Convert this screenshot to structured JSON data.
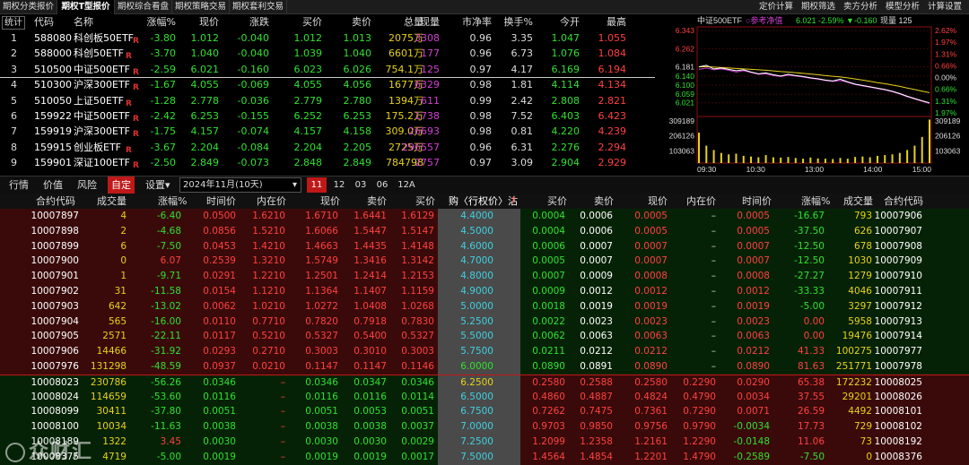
{
  "top_nav": {
    "tabs": [
      "期权分类报价",
      "期权T型报价",
      "期权综合看盘",
      "期权策略交易",
      "期权套利交易"
    ],
    "active": 1,
    "right_tools": [
      "定价计算",
      "期权筛选",
      "卖方分析",
      "模型分析",
      "计算设置"
    ]
  },
  "quote_table": {
    "corner_label": "统计",
    "headers": {
      "code": "代码",
      "name": "名称",
      "chg_pct": "涨幅%",
      "price": "现价",
      "diff": "涨跌",
      "bid": "买价",
      "ask": "卖价",
      "vol": "总量",
      "cur": "现量",
      "pb": "市净率",
      "turn": "换手%",
      "open": "今开",
      "high": "最高"
    },
    "rows": [
      {
        "idx": "1",
        "code": "588080",
        "name": "科创板50ETF",
        "r": "R",
        "chg": "-3.80",
        "price": "1.012",
        "diff": "-0.040",
        "bid": "1.012",
        "ask": "1.013",
        "vol": "2075万",
        "cur": "3308",
        "pb": "0.96",
        "turn": "3.35",
        "open": "1.047",
        "high": "1.055"
      },
      {
        "idx": "2",
        "code": "588000",
        "name": "科创50ETF",
        "r": "R",
        "chg": "-3.70",
        "price": "1.040",
        "diff": "-0.040",
        "bid": "1.039",
        "ask": "1.040",
        "vol": "6601万",
        "cur": "177",
        "pb": "0.96",
        "turn": "6.73",
        "open": "1.076",
        "high": "1.084"
      },
      {
        "idx": "3",
        "code": "510500",
        "name": "中证500ETF",
        "r": "R",
        "chg": "-2.59",
        "price": "6.021",
        "diff": "-0.160",
        "bid": "6.023",
        "ask": "6.026",
        "vol": "754.1万",
        "cur": "125",
        "pb": "0.97",
        "turn": "4.17",
        "open": "6.169",
        "high": "6.194"
      },
      {
        "idx": "4",
        "code": "510300",
        "name": "沪深300ETF",
        "r": "R",
        "chg": "-1.67",
        "price": "4.055",
        "diff": "-0.069",
        "bid": "4.055",
        "ask": "4.056",
        "vol": "1677万",
        "cur": "6329",
        "pb": "0.98",
        "turn": "1.81",
        "open": "4.114",
        "high": "4.134"
      },
      {
        "idx": "5",
        "code": "510050",
        "name": "上证50ETF",
        "r": "R",
        "chg": "-1.28",
        "price": "2.778",
        "diff": "-0.036",
        "bid": "2.779",
        "ask": "2.780",
        "vol": "1394万",
        "cur": "611",
        "pb": "0.99",
        "turn": "2.42",
        "open": "2.808",
        "high": "2.821"
      },
      {
        "idx": "6",
        "code": "159922",
        "name": "中证500ETF",
        "r": "R",
        "chg": "-2.42",
        "price": "6.253",
        "diff": "-0.155",
        "bid": "6.252",
        "ask": "6.253",
        "vol": "175.2万",
        "cur": "1738",
        "pb": "0.98",
        "turn": "7.52",
        "open": "6.403",
        "high": "6.423"
      },
      {
        "idx": "7",
        "code": "159919",
        "name": "沪深300ETF",
        "r": "R",
        "chg": "-1.75",
        "price": "4.157",
        "diff": "-0.074",
        "bid": "4.157",
        "ask": "4.158",
        "vol": "309.0万",
        "cur": "26693",
        "pb": "0.98",
        "turn": "0.81",
        "open": "4.220",
        "high": "4.239"
      },
      {
        "idx": "8",
        "code": "159915",
        "name": "创业板ETF",
        "r": "R",
        "chg": "-3.67",
        "price": "2.204",
        "diff": "-0.084",
        "bid": "2.204",
        "ask": "2.205",
        "vol": "2725万",
        "cur": "296557",
        "pb": "0.96",
        "turn": "6.31",
        "open": "2.276",
        "high": "2.294"
      },
      {
        "idx": "9",
        "code": "159901",
        "name": "深证100ETF",
        "r": "R",
        "chg": "-2.50",
        "price": "2.849",
        "diff": "-0.073",
        "bid": "2.848",
        "ask": "2.849",
        "vol": "784798",
        "cur": "2757",
        "pb": "0.97",
        "turn": "3.09",
        "open": "2.904",
        "high": "2.929"
      }
    ]
  },
  "mini_chart": {
    "title": "中证500ETF",
    "ref_label": "参考净值",
    "price": "6.021",
    "pct": "-2.59%",
    "diff": "▼-0.160",
    "cur_vol_label": "现量",
    "cur_vol": "125",
    "left_ticks": [
      "6.343",
      "6.262",
      "6.181",
      "6.140",
      "6.100",
      "6.059",
      "6.021"
    ],
    "right_ticks": [
      "2.62%",
      "1.97%",
      "1.31%",
      "0.66%",
      "0.00%",
      "0.66%",
      "1.31%",
      "1.97%"
    ],
    "vol_left": [
      "309189",
      "206126",
      "103063"
    ],
    "vol_right": [
      "309189",
      "206126",
      "103063"
    ],
    "time_ticks": [
      "09:30",
      "10:30",
      "13:00",
      "14:00",
      "15:00"
    ],
    "price_line": [
      6.181,
      6.188,
      6.172,
      6.176,
      6.17,
      6.164,
      6.168,
      6.158,
      6.15,
      6.154,
      6.146,
      6.14,
      6.148,
      6.142,
      6.138,
      6.132,
      6.128,
      6.122,
      6.118,
      6.126,
      6.114,
      6.104,
      6.098,
      6.092,
      6.086,
      6.08,
      6.072,
      6.062,
      6.05,
      6.04,
      6.03,
      6.021
    ],
    "avg_line": [
      6.181,
      6.182,
      6.18,
      6.178,
      6.176,
      6.174,
      6.172,
      6.17,
      6.168,
      6.166,
      6.163,
      6.16,
      6.158,
      6.155,
      6.152,
      6.149,
      6.146,
      6.142,
      6.139,
      6.136,
      6.132,
      6.127,
      6.122,
      6.117,
      6.111,
      6.106,
      6.1,
      6.094,
      6.087,
      6.08,
      6.073,
      6.066
    ],
    "ref_line": [
      6.17,
      6.176,
      6.168,
      6.172,
      6.166,
      6.158,
      6.164,
      6.156,
      6.148,
      6.15,
      6.142,
      6.138,
      6.144,
      6.14,
      6.136,
      6.13,
      6.126,
      6.12,
      6.116,
      6.12,
      6.112,
      6.102,
      6.096,
      6.09,
      6.084,
      6.078,
      6.07,
      6.06,
      6.048,
      6.038,
      6.028,
      6.018
    ],
    "volume": [
      210000,
      120000,
      90000,
      70000,
      60000,
      65000,
      50000,
      45000,
      40000,
      55000,
      40000,
      38000,
      42000,
      35000,
      30000,
      38000,
      32000,
      30000,
      28000,
      35000,
      30000,
      42000,
      45000,
      40000,
      50000,
      55000,
      60000,
      70000,
      90000,
      120000,
      180000,
      300000
    ]
  },
  "chain_tabs": {
    "tabs": [
      "行情",
      "价值",
      "风险",
      "自定",
      "设置▾"
    ],
    "active_tab": 3,
    "expiry": "2024年11月(10天)",
    "months": [
      "11",
      "12",
      "03",
      "06",
      "12A"
    ],
    "active_month": 0
  },
  "chain_headers": {
    "left": [
      "合约代码",
      "成交量",
      "涨幅%",
      "时间价",
      "内在价",
      "现价",
      "卖价",
      "买价"
    ],
    "strike": "购〈行权价〉沽",
    "right": [
      "买价",
      "卖价",
      "现价",
      "内在价",
      "时间价",
      "涨幅%",
      "成交量",
      "合约代码"
    ]
  },
  "chain_rows": [
    {
      "lc": "10007897",
      "lv": "4",
      "lchg": "-6.40",
      "lt": "0.0500",
      "li": "1.6210",
      "lp": "1.6710",
      "la": "1.6441",
      "lb": "1.6129",
      "k": "4.4000",
      "rb": "0.0004",
      "ra": "0.0006",
      "rp": "0.0005",
      "ri": "–",
      "rt": "0.0005",
      "rchg": "-16.67",
      "rv": "793",
      "rc": "10007906"
    },
    {
      "lc": "10007898",
      "lv": "2",
      "lchg": "-4.68",
      "lt": "0.0856",
      "li": "1.5210",
      "lp": "1.6066",
      "la": "1.5447",
      "lb": "1.5147",
      "k": "4.5000",
      "rb": "0.0004",
      "ra": "0.0006",
      "rp": "0.0005",
      "ri": "–",
      "rt": "0.0005",
      "rchg": "-37.50",
      "rv": "626",
      "rc": "10007907"
    },
    {
      "lc": "10007899",
      "lv": "6",
      "lchg": "-7.50",
      "lt": "0.0453",
      "li": "1.4210",
      "lp": "1.4663",
      "la": "1.4435",
      "lb": "1.4148",
      "k": "4.6000",
      "rb": "0.0006",
      "ra": "0.0007",
      "rp": "0.0007",
      "ri": "–",
      "rt": "0.0007",
      "rchg": "-12.50",
      "rv": "678",
      "rc": "10007908"
    },
    {
      "lc": "10007900",
      "lv": "0",
      "lchg": "6.07",
      "lt": "0.2539",
      "li": "1.3210",
      "lp": "1.5749",
      "la": "1.3416",
      "lb": "1.3142",
      "k": "4.7000",
      "rb": "0.0005",
      "ra": "0.0007",
      "rp": "0.0007",
      "ri": "–",
      "rt": "0.0007",
      "rchg": "-12.50",
      "rv": "1030",
      "rc": "10007909"
    },
    {
      "lc": "10007901",
      "lv": "1",
      "lchg": "-9.71",
      "lt": "0.0291",
      "li": "1.2210",
      "lp": "1.2501",
      "la": "1.2414",
      "lb": "1.2153",
      "k": "4.8000",
      "rb": "0.0007",
      "ra": "0.0009",
      "rp": "0.0008",
      "ri": "–",
      "rt": "0.0008",
      "rchg": "-27.27",
      "rv": "1279",
      "rc": "10007910"
    },
    {
      "lc": "10007902",
      "lv": "31",
      "lchg": "-11.58",
      "lt": "0.0154",
      "li": "1.1210",
      "lp": "1.1364",
      "la": "1.1407",
      "lb": "1.1159",
      "k": "4.9000",
      "rb": "0.0009",
      "ra": "0.0012",
      "rp": "0.0012",
      "ri": "–",
      "rt": "0.0012",
      "rchg": "-33.33",
      "rv": "4046",
      "rc": "10007911"
    },
    {
      "lc": "10007903",
      "lv": "642",
      "lchg": "-13.02",
      "lt": "0.0062",
      "li": "1.0210",
      "lp": "1.0272",
      "la": "1.0408",
      "lb": "1.0268",
      "k": "5.0000",
      "rb": "0.0018",
      "ra": "0.0019",
      "rp": "0.0019",
      "ri": "–",
      "rt": "0.0019",
      "rchg": "-5.00",
      "rv": "3297",
      "rc": "10007912"
    },
    {
      "lc": "10007904",
      "lv": "565",
      "lchg": "-16.00",
      "lt": "0.0110",
      "li": "0.7710",
      "lp": "0.7820",
      "la": "0.7918",
      "lb": "0.7830",
      "k": "5.2500",
      "rb": "0.0022",
      "ra": "0.0023",
      "rp": "0.0023",
      "ri": "–",
      "rt": "0.0023",
      "rchg": "0.00",
      "rv": "5958",
      "rc": "10007913"
    },
    {
      "lc": "10007905",
      "lv": "2571",
      "lchg": "-22.11",
      "lt": "0.0117",
      "li": "0.5210",
      "lp": "0.5327",
      "la": "0.5400",
      "lb": "0.5327",
      "k": "5.5000",
      "rb": "0.0062",
      "ra": "0.0063",
      "rp": "0.0063",
      "ri": "–",
      "rt": "0.0063",
      "rchg": "0.00",
      "rv": "19476",
      "rc": "10007914"
    },
    {
      "lc": "10007906",
      "lv": "14466",
      "lchg": "-31.92",
      "lt": "0.0293",
      "li": "0.2710",
      "lp": "0.3003",
      "la": "0.3010",
      "lb": "0.3003",
      "k": "5.7500",
      "rb": "0.0211",
      "ra": "0.0212",
      "rp": "0.0212",
      "ri": "–",
      "rt": "0.0212",
      "rchg": "41.33",
      "rv": "100275",
      "rc": "10007977"
    },
    {
      "lc": "10007976",
      "lv": "131298",
      "lchg": "-48.59",
      "lt": "0.0937",
      "li": "0.0210",
      "lp": "0.1147",
      "la": "0.1147",
      "lb": "0.1146",
      "k": "6.0000",
      "rb": "0.0890",
      "ra": "0.0891",
      "rp": "0.0890",
      "ri": "–",
      "rt": "0.0890",
      "rchg": "81.63",
      "rv": "251771",
      "rc": "10007978"
    },
    {
      "lc": "10008023",
      "lv": "230786",
      "lchg": "-56.26",
      "lt": "0.0346",
      "li": "–",
      "lp": "0.0346",
      "la": "0.0347",
      "lb": "0.0346",
      "k": "6.2500",
      "rb": "0.2580",
      "ra": "0.2588",
      "rp": "0.2580",
      "ri": "0.2290",
      "rt": "0.0290",
      "rchg": "65.38",
      "rv": "172232",
      "rc": "10008025"
    },
    {
      "lc": "10008024",
      "lv": "114659",
      "lchg": "-53.60",
      "lt": "0.0116",
      "li": "–",
      "lp": "0.0116",
      "la": "0.0116",
      "lb": "0.0114",
      "k": "6.5000",
      "rb": "0.4860",
      "ra": "0.4887",
      "rp": "0.4824",
      "ri": "0.4790",
      "rt": "0.0034",
      "rchg": "37.55",
      "rv": "29201",
      "rc": "10008026"
    },
    {
      "lc": "10008099",
      "lv": "30411",
      "lchg": "-37.80",
      "lt": "0.0051",
      "li": "–",
      "lp": "0.0051",
      "la": "0.0053",
      "lb": "0.0051",
      "k": "6.7500",
      "rb": "0.7262",
      "ra": "0.7475",
      "rp": "0.7361",
      "ri": "0.7290",
      "rt": "0.0071",
      "rchg": "26.59",
      "rv": "4492",
      "rc": "10008101"
    },
    {
      "lc": "10008100",
      "lv": "10034",
      "lchg": "-11.63",
      "lt": "0.0038",
      "li": "–",
      "lp": "0.0038",
      "la": "0.0038",
      "lb": "0.0037",
      "k": "7.0000",
      "rb": "0.9703",
      "ra": "0.9850",
      "rp": "0.9756",
      "ri": "0.9790",
      "rt": "-0.0034",
      "rchg": "17.73",
      "rv": "729",
      "rc": "10008102"
    },
    {
      "lc": "10008189",
      "lv": "1322",
      "lchg": "3.45",
      "lt": "0.0030",
      "li": "–",
      "lp": "0.0030",
      "la": "0.0030",
      "lb": "0.0029",
      "k": "7.2500",
      "rb": "1.2099",
      "ra": "1.2358",
      "rp": "1.2161",
      "ri": "1.2290",
      "rt": "-0.0148",
      "rchg": "11.06",
      "rv": "73",
      "rc": "10008192"
    },
    {
      "lc": "10008375",
      "lv": "4719",
      "lchg": "-5.00",
      "lt": "0.0019",
      "li": "–",
      "lp": "0.0019",
      "la": "0.0019",
      "lb": "0.0017",
      "k": "7.5000",
      "rb": "1.4564",
      "ra": "1.4854",
      "rp": "1.2201",
      "ri": "1.4790",
      "rt": "-0.2589",
      "rchg": "-7.50",
      "rv": "0",
      "rc": "10008376"
    }
  ],
  "watermark": "众财汇"
}
